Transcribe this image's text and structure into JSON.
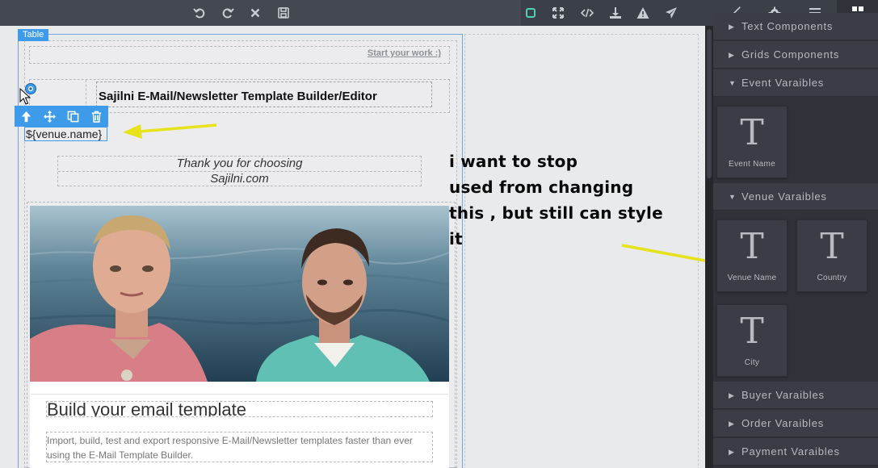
{
  "topbar": {
    "left_icons": [
      "undo-icon",
      "redo-icon",
      "clear-icon",
      "save-icon"
    ],
    "right_icons": [
      "component-outline-icon",
      "fullscreen-icon",
      "code-icon",
      "download-icon",
      "warning-icon",
      "send-icon"
    ],
    "panel_tabs": [
      "style-manager-icon",
      "settings-icon",
      "layer-manager-icon",
      "blocks-icon"
    ]
  },
  "canvas": {
    "selected_badge": "Table",
    "start_link": "Start your work :)",
    "header_title": "Sajilni E-Mail/Newsletter Template Builder/Editor",
    "venue_placeholder": "${venue.name}",
    "thanks_line1": "Thank you for choosing",
    "thanks_line2": "Sajilni.com",
    "card_heading": "Build your email template",
    "card_body": "Import, build, test and export responsive E-Mail/Newsletter templates faster than ever using the E-Mail Template Builder."
  },
  "annotation": {
    "line1": "i want to stop",
    "line2": "used from changing",
    "line3": "this , but still can style",
    "line4": "it"
  },
  "side_panel": {
    "categories": {
      "text_components": "Text Components",
      "grids_components": "Grids Components",
      "event_variables": "Event Varaibles",
      "venue_variables": "Venue Varaibles",
      "buyer_variables": "Buyer Varaibles",
      "order_variables": "Order Varaibles",
      "payment_variables": "Payment Varaibles"
    },
    "tile_glyph": "T",
    "blocks": {
      "event_name": "Event Name",
      "venue_name": "Venue Name",
      "country": "Country",
      "city": "City"
    }
  },
  "colors": {
    "accent_blue": "#3d9be9",
    "active_tab_underline": "#4ed3b5",
    "arrow_yellow": "#e6e21c",
    "panel_bg": "#2f3239"
  }
}
